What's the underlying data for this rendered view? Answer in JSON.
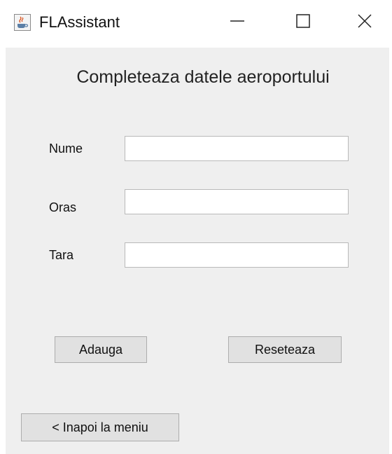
{
  "window": {
    "title": "FLAssistant",
    "controls": {
      "minimize": "minimize",
      "maximize": "maximize",
      "close": "close"
    }
  },
  "form": {
    "heading": "Completeaza datele aeroportului",
    "fields": [
      {
        "label": "Nume",
        "value": ""
      },
      {
        "label": "Oras",
        "value": ""
      },
      {
        "label": "Tara",
        "value": ""
      }
    ],
    "add_button": "Adauga",
    "reset_button": "Reseteaza",
    "back_button": "< Inapoi la meniu"
  },
  "icons": {
    "app": "java-cup-icon",
    "minimize": "minimize-icon",
    "maximize": "maximize-icon",
    "close": "close-icon"
  }
}
